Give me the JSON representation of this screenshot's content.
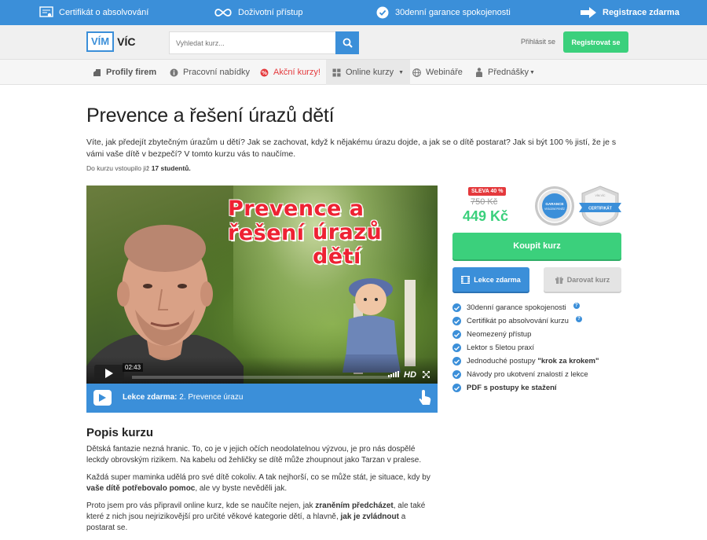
{
  "promo": {
    "certificate": "Certifikát o absolvování",
    "lifetime": "Doživotní přístup",
    "guarantee": "30denní garance spokojenosti",
    "register": "Registrace zdarma"
  },
  "header": {
    "logo_box": "VÍM",
    "logo_text": "VÍC",
    "search_placeholder": "Vyhledat kurz...",
    "login": "Přihlásit se",
    "register": "Registrovat se"
  },
  "nav": {
    "items": [
      {
        "label": "Profily firem"
      },
      {
        "label": "Pracovní nabídky"
      },
      {
        "label": "Akční kurzy!"
      },
      {
        "label": "Online kurzy"
      },
      {
        "label": "Webináře"
      },
      {
        "label": "Přednášky"
      }
    ]
  },
  "course": {
    "title": "Prevence a řešení úrazů dětí",
    "intro": "Víte, jak předejít zbytečným úrazům u dětí? Jak se zachovat, když k nějakému úrazu dojde, a jak se o dítě postarat? Jak si být 100 % jistí, že je s vámi vaše dítě v bezpečí? V tomto kurzu vás to naučíme.",
    "students_prefix": "Do kurzu vstoupilo již",
    "students_count": "17 studentů."
  },
  "video": {
    "title_line1": "Prevence a řešení",
    "title_line2": "úrazů dětí",
    "time": "02:43",
    "hd": "HD"
  },
  "lesson": {
    "prefix": "Lekce zdarma:",
    "name": "2. Prevence úrazu"
  },
  "description": {
    "heading": "Popis kurzu",
    "p1": "Dětská fantazie nezná hranic. To, co je v jejich očích neodolatelnou výzvou, je pro nás dospělé leckdy obrovským rizikem. Na kabelu od žehličky se dítě může zhoupnout jako Tarzan v pralese.",
    "p2_pre": "Každá super maminka udělá pro své dítě cokoliv. A tak nejhorší, co se může stát, je situace, kdy by ",
    "p2_bold": "vaše dítě potřebovalo pomoc",
    "p2_post": ", ale vy byste nevěděli jak.",
    "p3_pre": "Proto jsem pro vás připravil online kurz, kde se naučíte nejen, jak ",
    "p3_bold1": "zraněním předcházet",
    "p3_mid": ", ale také které z nich jsou nejrizikovější pro určité věkové kategorie dětí, a hlavně, ",
    "p3_bold2": "jak je zvládnout",
    "p3_post": " a postarat se."
  },
  "pricing": {
    "sale": "SLEVA 40 %",
    "old_price": "750 Kč",
    "new_price": "449 Kč",
    "badge1": "GARANCE VRÁCENÍ PENĚZ",
    "badge2": "CERTIFIKÁT",
    "badge2_top": "VÍM VÍC",
    "buy": "Koupit kurz",
    "free_lessons": "Lekce zdarma",
    "gift": "Darovat kurz"
  },
  "features": {
    "f1": "30denní garance spokojenosti",
    "f2": "Certifikát po absolvování kurzu",
    "f3": "Neomezený přístup",
    "f4": "Lektor s 5letou praxí",
    "f5_pre": "Jednoduché postupy ",
    "f5_bold": "\"krok za krokem\"",
    "f6": "Návody pro ukotvení znalostí z lekce",
    "f7": "PDF s postupy ke stažení"
  },
  "colors": {
    "primary_blue": "#3b8fd9",
    "green": "#3bd07c",
    "red": "#e4393c"
  }
}
